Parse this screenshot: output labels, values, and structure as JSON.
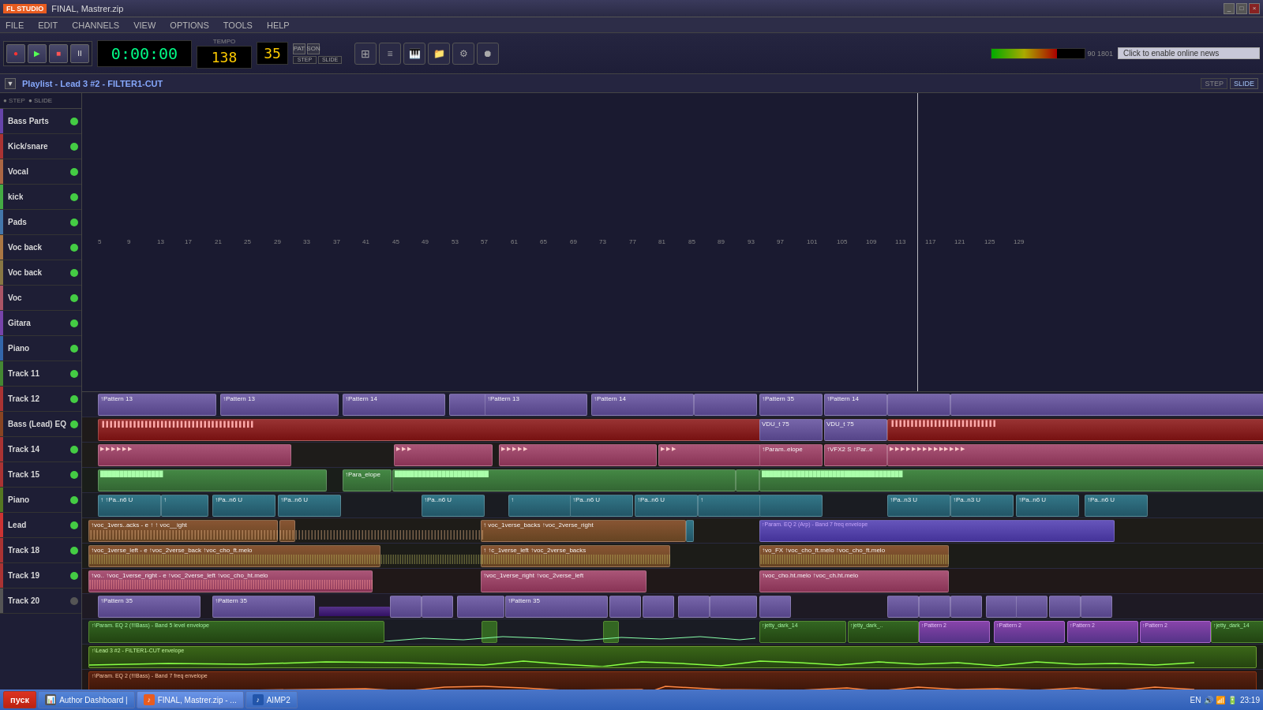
{
  "titlebar": {
    "logo": "FL STUDIO",
    "title": "FINAL, Mastrer.zip",
    "win_controls": [
      "_",
      "□",
      "×"
    ]
  },
  "menubar": {
    "items": [
      "FILE",
      "EDIT",
      "CHANNELS",
      "VIEW",
      "OPTIONS",
      "TOOLS",
      "HELP"
    ]
  },
  "transport": {
    "time_display": "0:00:00",
    "bpm": "138",
    "tempo_label": "TEMPO",
    "buttons": [
      "REC",
      "PLAY",
      "STOP",
      "PAT"
    ],
    "song_label": "35"
  },
  "playlist": {
    "title": "Playlist - Lead 3 #2 - FILTER1-CUT",
    "ruler_numbers": [
      "5",
      "9",
      "13",
      "17",
      "21",
      "25",
      "29",
      "33",
      "37",
      "41",
      "45",
      "49",
      "53",
      "57",
      "61",
      "65",
      "69",
      "73",
      "77",
      "81",
      "85",
      "89",
      "93",
      "97",
      "101",
      "105",
      "109",
      "113",
      "117",
      "121",
      "125",
      "129"
    ]
  },
  "tracks": [
    {
      "name": "Bass Parts",
      "color": "#6644aa",
      "mute": "green"
    },
    {
      "name": "Kick/snare",
      "color": "#aa4444",
      "mute": "green"
    },
    {
      "name": "Vocal",
      "color": "#aa6644",
      "mute": "green"
    },
    {
      "name": "kick",
      "color": "#44aa44",
      "mute": "green"
    },
    {
      "name": "Pads",
      "color": "#4477aa",
      "mute": "green"
    },
    {
      "name": "Voc back",
      "color": "#aa7744",
      "mute": "green"
    },
    {
      "name": "Voc back",
      "color": "#887744",
      "mute": "green"
    },
    {
      "name": "Voc",
      "color": "#aa5566",
      "mute": "green"
    },
    {
      "name": "Gitara",
      "color": "#7744aa",
      "mute": "green"
    },
    {
      "name": "Piano",
      "color": "#3366aa",
      "mute": "green"
    },
    {
      "name": "Track 11",
      "color": "#448833",
      "mute": "green"
    },
    {
      "name": "Track 12",
      "color": "#aa3333",
      "mute": "green"
    },
    {
      "name": "Bass (Lead) EQ",
      "color": "#884422",
      "mute": "green"
    },
    {
      "name": "Track 14",
      "color": "#aa3333",
      "mute": "green"
    },
    {
      "name": "Track 15",
      "color": "#aa3333",
      "mute": "green"
    },
    {
      "name": "Piano",
      "color": "#557722",
      "mute": "green"
    },
    {
      "name": "Lead",
      "color": "#cc3333",
      "mute": "green"
    },
    {
      "name": "Track 18",
      "color": "#aa3333",
      "mute": "green"
    },
    {
      "name": "Track 19",
      "color": "#aa3333",
      "mute": "green"
    },
    {
      "name": "Track 20",
      "color": "#555555",
      "mute": "green"
    }
  ],
  "taskbar": {
    "start_label": "пуск",
    "items": [
      {
        "label": "Author Dashboard |",
        "icon": "📊"
      },
      {
        "label": "FINAL, Mastrer.zip - ...",
        "icon": "🎵"
      },
      {
        "label": "AIMP2",
        "icon": "♪"
      }
    ],
    "system": {
      "lang": "EN",
      "time": "23:19"
    }
  }
}
